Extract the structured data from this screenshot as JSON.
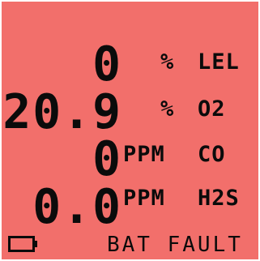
{
  "colors": {
    "screen_background": "#f26f6b",
    "text": "#0b0b0b"
  },
  "readings": [
    {
      "value": "0",
      "unit_prefix": "%",
      "unit": "LEL"
    },
    {
      "value": "20.9",
      "unit_prefix": "%",
      "unit": "O2"
    },
    {
      "value": "0",
      "unit_prefix": "PPM",
      "unit": "CO"
    },
    {
      "value": "0.0",
      "unit_prefix": "PPM",
      "unit": "H2S"
    }
  ],
  "status": {
    "battery_icon": "battery-empty-icon",
    "message": "BAT FAULT"
  }
}
